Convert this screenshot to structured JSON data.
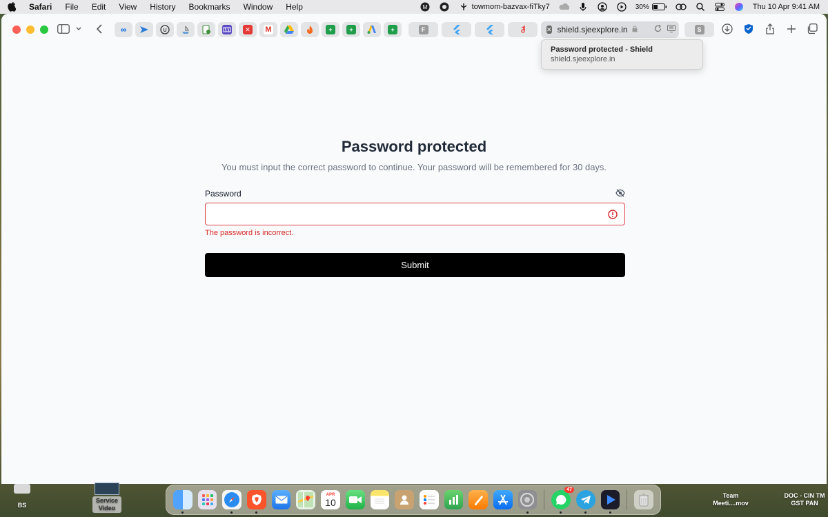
{
  "menubar": {
    "app_name": "Safari",
    "items": [
      "File",
      "Edit",
      "View",
      "History",
      "Bookmarks",
      "Window",
      "Help"
    ],
    "proxy_label": "towmom-bazvax-fiTky7",
    "battery": "30%",
    "clock": "Thu 10 Apr  9:41 AM"
  },
  "tab": {
    "url": "shield.sjeexplore.in"
  },
  "tooltip": {
    "title": "Password protected - Shield",
    "subtitle": "shield.sjeexplore.in"
  },
  "page": {
    "heading": "Password protected",
    "subtitle": "You must input the correct password to continue. Your password will be remembered for 30 days.",
    "password_label": "Password",
    "password_value": "",
    "error_text": "The password is incorrect.",
    "submit_label": "Submit",
    "error_color": "#dc2626"
  },
  "desktop": {
    "left_label": "BS",
    "service_video_label": "Service Video",
    "team_label": "Team Meeti....mov",
    "doc_label": "DOC - CIN TM GST PAN"
  },
  "dock": {
    "calendar_month": "APR",
    "calendar_day": "10",
    "whatsapp_badge": "47"
  }
}
